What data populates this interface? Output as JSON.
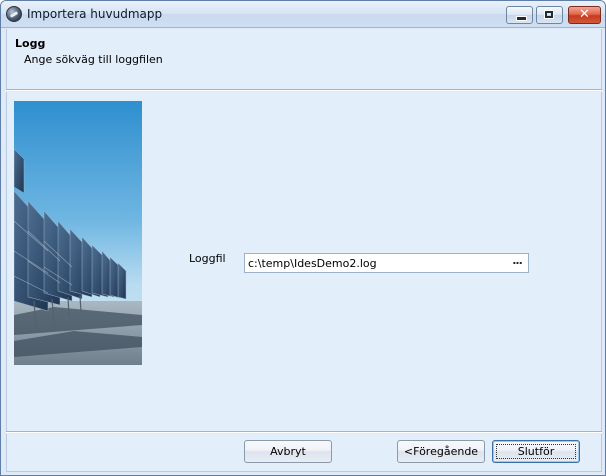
{
  "window": {
    "title": "Importera huvudmapp"
  },
  "header": {
    "title": "Logg",
    "subtitle": "Ange sökväg till loggfilen"
  },
  "form": {
    "log_label": "Loggfil",
    "log_path": "c:\\temp\\IdesDemo2.log",
    "browse_label": "..."
  },
  "buttons": {
    "cancel": "Avbryt",
    "previous": "<Föregående",
    "finish": "Slutför"
  },
  "colors": {
    "background": "#dfeaf6",
    "panel": "#e3eefb",
    "close_button": "#c73a1c"
  },
  "icons": {
    "app": "globe-icon",
    "minimize": "minimize-icon",
    "maximize": "maximize-icon",
    "close": "close-icon",
    "browse": "ellipsis-icon"
  }
}
